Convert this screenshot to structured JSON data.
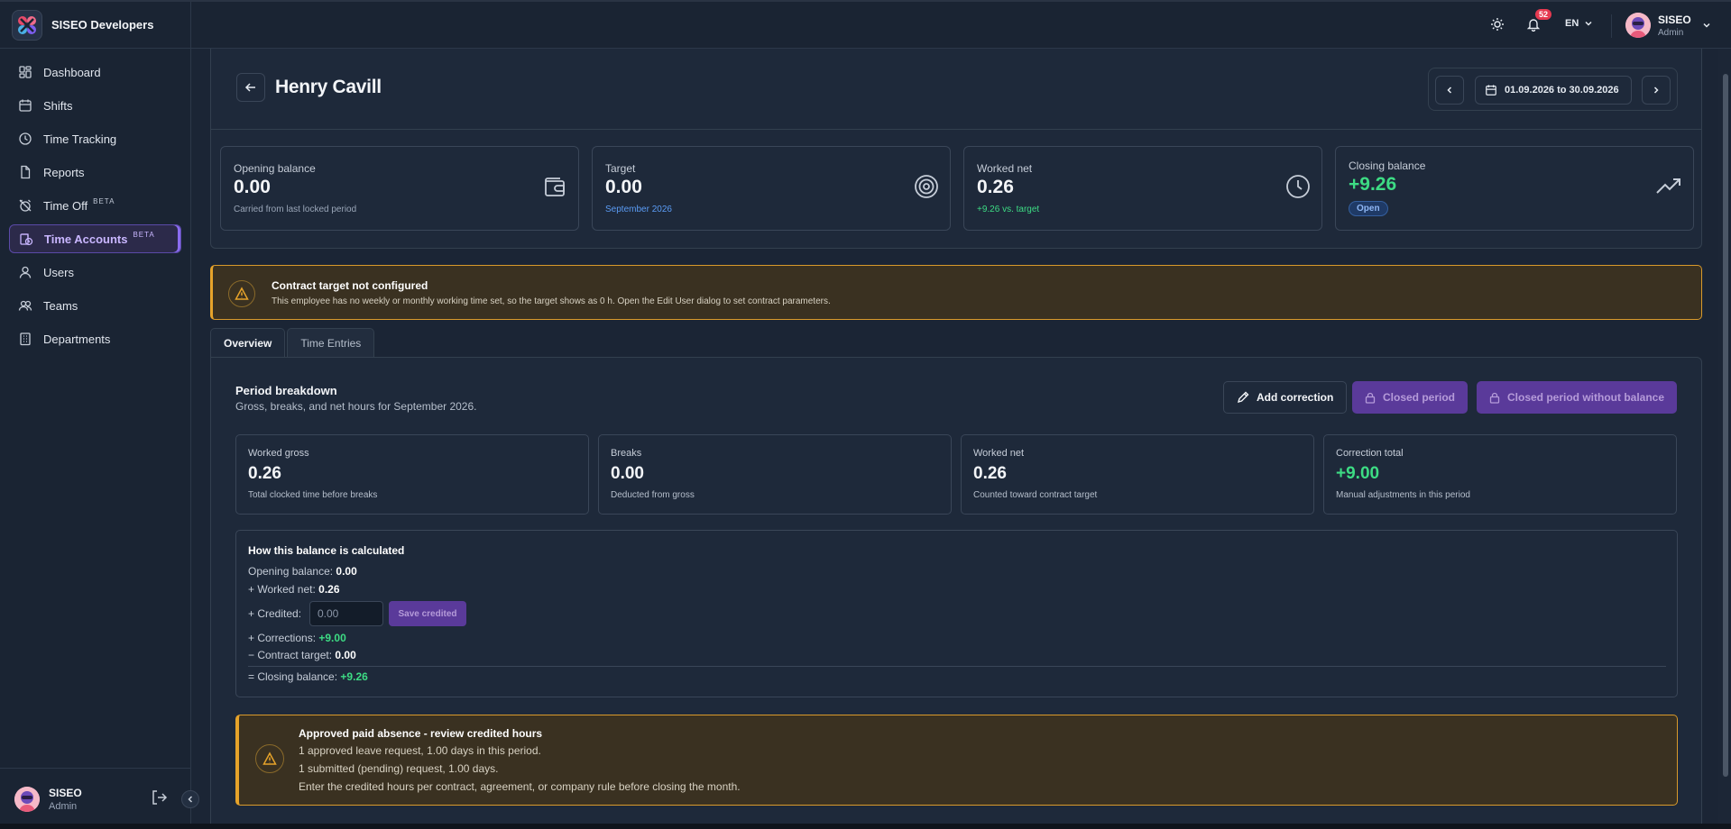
{
  "app": {
    "name": "SISEO Developers"
  },
  "sidebar": {
    "items": [
      {
        "label": "Dashboard"
      },
      {
        "label": "Shifts"
      },
      {
        "label": "Time Tracking"
      },
      {
        "label": "Reports"
      },
      {
        "label": "Time Off",
        "badge": "BETA"
      },
      {
        "label": "Time Accounts",
        "badge": "BETA",
        "active": true
      },
      {
        "label": "Users"
      },
      {
        "label": "Teams"
      },
      {
        "label": "Departments"
      }
    ],
    "user": {
      "name": "SISEO",
      "role": "Admin"
    }
  },
  "topbar": {
    "notifications_count": "52",
    "language": "EN",
    "user": {
      "name": "SISEO",
      "role": "Admin"
    }
  },
  "header": {
    "title": "Henry Cavill",
    "date_range": "01.09.2026 to 30.09.2026"
  },
  "stats": [
    {
      "label": "Opening balance",
      "value": "0.00",
      "sub": "Carried from last locked period",
      "icon": "wallet-icon"
    },
    {
      "label": "Target",
      "value": "0.00",
      "sub": "September 2026",
      "icon": "target-icon"
    },
    {
      "label": "Worked net",
      "value": "0.26",
      "sub": "+9.26 vs. target",
      "icon": "clock-icon"
    },
    {
      "label": "Closing balance",
      "value": "+9.26",
      "badge": "Open",
      "icon": "trending-up-icon"
    }
  ],
  "warning": {
    "title": "Contract target not configured",
    "text": "This employee has no weekly or monthly working time set, so the target shows as 0 h. Open the Edit User dialog to set contract parameters."
  },
  "tabs": [
    {
      "label": "Overview",
      "active": true
    },
    {
      "label": "Time Entries"
    }
  ],
  "breakdown": {
    "title": "Period breakdown",
    "subtitle": "Gross, breaks, and net hours for September 2026.",
    "buttons": {
      "add_correction": "Add correction",
      "closed_period": "Closed period",
      "closed_without_balance": "Closed period without balance"
    },
    "cards": [
      {
        "label": "Worked gross",
        "value": "0.26",
        "sub": "Total clocked time before breaks"
      },
      {
        "label": "Breaks",
        "value": "0.00",
        "sub": "Deducted from gross"
      },
      {
        "label": "Worked net",
        "value": "0.26",
        "sub": "Counted toward contract target"
      },
      {
        "label": "Correction total",
        "value": "+9.00",
        "sub": "Manual adjustments in this period"
      }
    ]
  },
  "calculation": {
    "title": "How this balance is calculated",
    "opening_label": "Opening balance:",
    "opening_value": "0.00",
    "worked_label": "+ Worked net:",
    "worked_value": "0.26",
    "credited_label": "+ Credited:",
    "credited_placeholder": "0.00",
    "save_label": "Save credited",
    "corrections_label": "+ Corrections:",
    "corrections_value": "+9.00",
    "target_label": "− Contract target:",
    "target_value": "0.00",
    "closing_label": "= Closing balance:",
    "closing_value": "+9.26"
  },
  "absence": {
    "title": "Approved paid absence - review credited hours",
    "line1": "1 approved leave request, 1.00 days in this period.",
    "line2": "1 submitted (pending) request, 1.00 days.",
    "line3": "Enter the credited hours per contract, agreement, or company rule before closing the month."
  }
}
